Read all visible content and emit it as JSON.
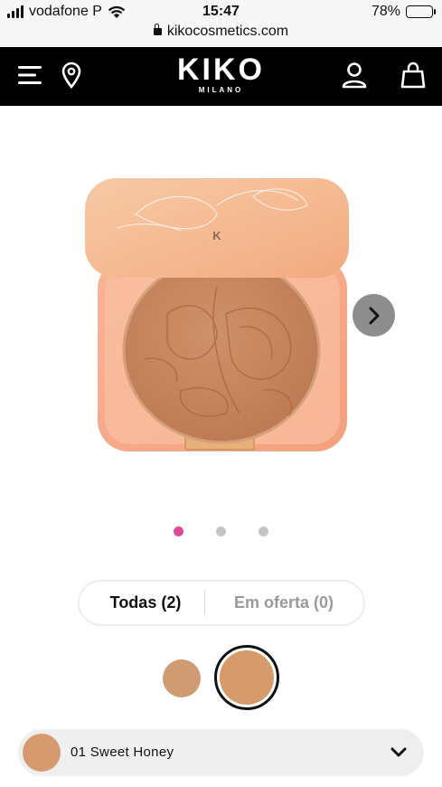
{
  "status_bar": {
    "carrier": "vodafone P",
    "time": "15:47",
    "battery": "78%",
    "battery_level": 0.78,
    "url": "kikocosmetics.com"
  },
  "header": {
    "logo_text": "KIKO",
    "logo_subtext": "MILANO",
    "icons": [
      "menu-icon",
      "location-pin-icon",
      "account-icon",
      "shopping-bag-icon"
    ]
  },
  "gallery": {
    "image_count": 3,
    "active_index": 0,
    "next_icon": "chevron-right-icon"
  },
  "filter": {
    "tabs": [
      {
        "label": "Todas (2)",
        "active": true
      },
      {
        "label": "Em oferta (0)",
        "active": false
      }
    ]
  },
  "swatches": {
    "colors": [
      "#cf9b72",
      "#d69a6b"
    ],
    "selected_index": 1
  },
  "shade_select": {
    "value": "01 Sweet Honey",
    "color": "#d59b6e",
    "chevron_icon": "chevron-down-icon"
  },
  "colors": {
    "accent": "#e0489a",
    "header_bg": "#000000"
  }
}
